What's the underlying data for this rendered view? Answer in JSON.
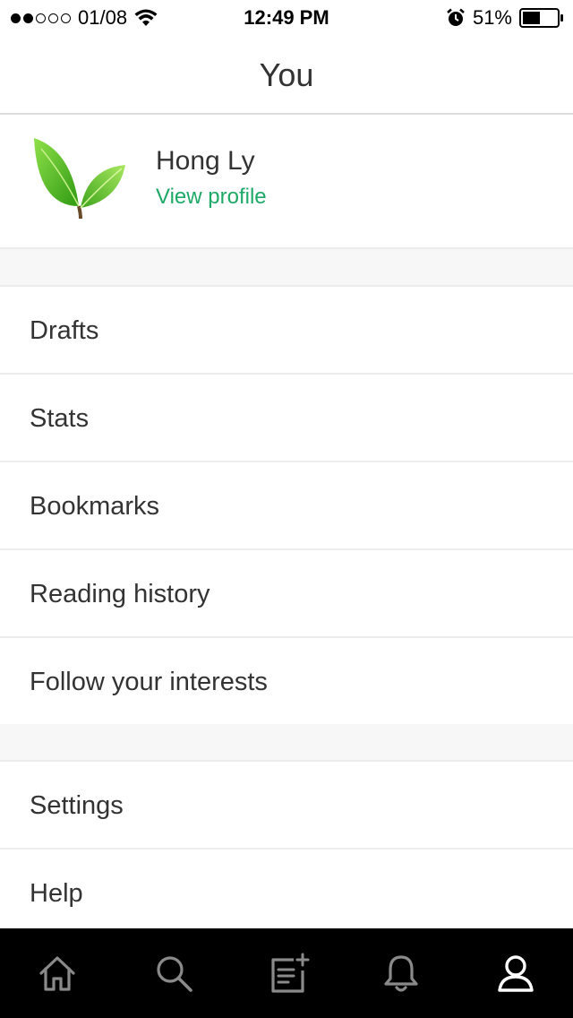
{
  "status_bar": {
    "carrier": "01/08",
    "time": "12:49 PM",
    "battery_percent": "51%",
    "battery_level": 0.51,
    "signal_bars_filled": 2,
    "signal_bars_total": 5,
    "icons": [
      "signal-dots-icon",
      "wifi-icon",
      "alarm-icon",
      "battery-icon"
    ]
  },
  "nav": {
    "title": "You"
  },
  "profile": {
    "name": "Hong Ly",
    "link_label": "View profile",
    "avatar_icon": "leaf-avatar-icon"
  },
  "menu_group_1": [
    {
      "label": "Drafts"
    },
    {
      "label": "Stats"
    },
    {
      "label": "Bookmarks"
    },
    {
      "label": "Reading history"
    },
    {
      "label": "Follow your interests"
    }
  ],
  "menu_group_2": [
    {
      "label": "Settings"
    },
    {
      "label": "Help"
    }
  ],
  "tab_bar": {
    "tabs": [
      {
        "icon": "home-icon",
        "active": false
      },
      {
        "icon": "search-icon",
        "active": false
      },
      {
        "icon": "new-story-icon",
        "active": false
      },
      {
        "icon": "bell-icon",
        "active": false
      },
      {
        "icon": "profile-icon",
        "active": true
      }
    ]
  },
  "colors": {
    "accent": "#1ea967",
    "tab_bar_bg": "#000000",
    "tab_inactive": "#8a8a8a",
    "tab_active": "#ffffff",
    "separator": "#ececec"
  }
}
